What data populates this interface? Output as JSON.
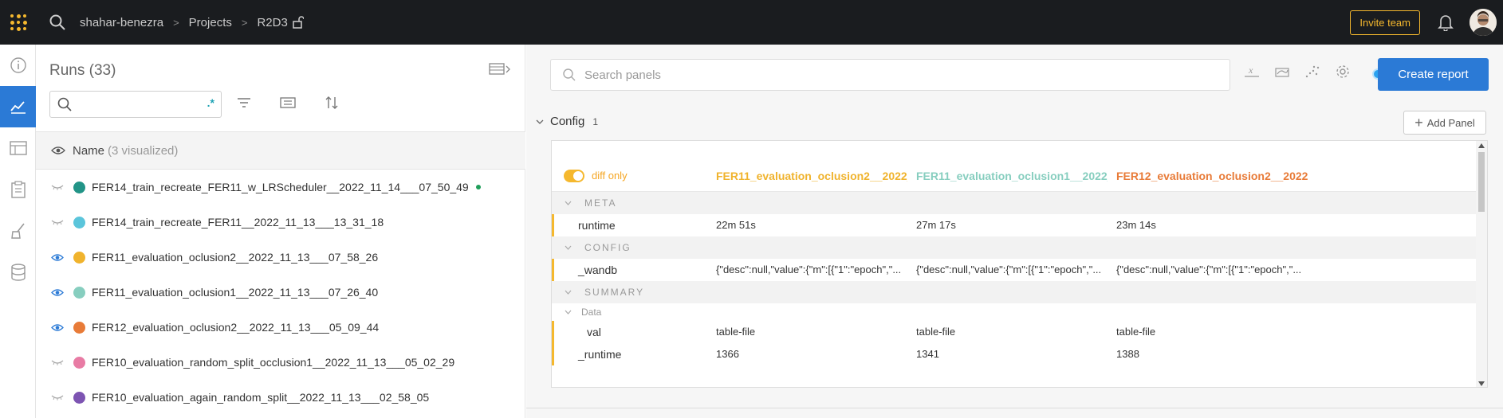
{
  "topbar": {
    "breadcrumb": [
      "shahar-benezra",
      "Projects",
      "R2D3"
    ],
    "invite_label": "Invite team"
  },
  "rail": {
    "items": [
      "info-icon",
      "charts-icon",
      "table-icon",
      "report-icon",
      "sweep-icon",
      "artifacts-icon"
    ],
    "active_index": 1
  },
  "runs": {
    "title": "Runs (33)",
    "search_value": "",
    "regex_label": ".*",
    "name_header": "Name",
    "visualized_label": "(3 visualized)",
    "rows": [
      {
        "name": "FER14_train_recreate_FER11_w_LRScheduler__2022_11_14___07_50_49",
        "color": "#229487",
        "visible": false,
        "live": true
      },
      {
        "name": "FER14_train_recreate_FER11__2022_11_13___13_31_18",
        "color": "#5bc5db",
        "visible": false,
        "live": false
      },
      {
        "name": "FER11_evaluation_oclusion2__2022_11_13___07_58_26",
        "color": "#f0b32d",
        "visible": true,
        "live": false
      },
      {
        "name": "FER11_evaluation_oclusion1__2022_11_13___07_26_40",
        "color": "#87cebf",
        "visible": true,
        "live": false
      },
      {
        "name": "FER12_evaluation_oclusion2__2022_11_13___05_09_44",
        "color": "#e87b38",
        "visible": true,
        "live": false
      },
      {
        "name": "FER10_evaluation_random_split_occlusion1__2022_11_13___05_02_29",
        "color": "#e87ba4",
        "visible": false,
        "live": false
      },
      {
        "name": "FER10_evaluation_again_random_split__2022_11_13___02_58_05",
        "color": "#7d54b2",
        "visible": false,
        "live": false
      }
    ]
  },
  "main": {
    "search_placeholder": "Search panels",
    "create_report_label": "Create report",
    "section_title": "Config",
    "section_count": "1",
    "add_panel_label": "Add Panel",
    "diff_only_label": "diff only",
    "columns": [
      {
        "label": "FER11_evaluation_oclusion2__2022_1...",
        "color": "#f0b32d"
      },
      {
        "label": "FER11_evaluation_oclusion1__2022_1...",
        "color": "#87cebf"
      },
      {
        "label": "FER12_evaluation_oclusion2__2022_1...",
        "color": "#e87b38"
      }
    ],
    "sections": {
      "meta": "META",
      "config": "CONFIG",
      "summary": "SUMMARY",
      "data": "Data"
    },
    "rows": {
      "runtime": {
        "key": "runtime",
        "values": [
          "22m 51s",
          "27m 17s",
          "23m 14s"
        ]
      },
      "wandb": {
        "key": "_wandb",
        "values": [
          "{\"desc\":null,\"value\":{\"m\":[{\"1\":\"epoch\",\"...",
          "{\"desc\":null,\"value\":{\"m\":[{\"1\":\"epoch\",\"...",
          "{\"desc\":null,\"value\":{\"m\":[{\"1\":\"epoch\",\"..."
        ]
      },
      "val": {
        "key": "val",
        "values": [
          "table-file",
          "table-file",
          "table-file"
        ]
      },
      "_runtime": {
        "key": "_runtime",
        "values": [
          "1366",
          "1341",
          "1388"
        ]
      }
    }
  }
}
